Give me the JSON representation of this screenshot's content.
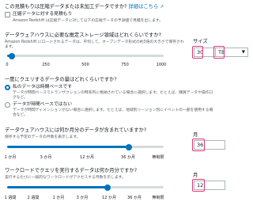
{
  "intro": {
    "question": "この見積もりは圧縮データまたは未加工データですか?",
    "link": "詳細はこちら",
    "checkbox_label": "圧縮データに対する見積もり",
    "checkbox_help": "Amazon Redshift は圧縮データに対して以下の圧縮データの予測値で見積を出します。"
  },
  "storage": {
    "question": "データウェアハウスに必要な推定ストレージ領域はどれくらいですか?",
    "help": "Amazon Redshift にロードされるデータは、平均して、オープンデータ形式の約3倍の大きさで保存されます。",
    "ticks": [
      "0",
      "250",
      "500",
      "750",
      "1000"
    ],
    "slider_fraction": 0.03,
    "size_label": "サイズ",
    "size_value": "30",
    "unit_value": "TB",
    "unit_caret": "▼"
  },
  "frequency": {
    "question": "一度にクエリするデータの量はどれくらいですか?",
    "option1_label": "私のデータは時間ベースです",
    "option1_help": "データが時間ベースでトランザクションの時系列に格納されている場合に選択します。たとえば、購買データや操作ログなど。",
    "option2_label": "データが時間ベースではない",
    "option2_help": "データが時間ディメンションがない場合に選択します。たとえば、地域別リージョン別にイベントの一部を使用する場合など。"
  },
  "months_stored": {
    "question": "データウェアハウスには何か月分のデータが含まれていますか?",
    "help": "保存する予定のデータの月数を表示します。",
    "ticks": [
      "1 か月",
      "3 か月",
      "12 か月",
      "36 か月",
      "無制限"
    ],
    "slider_fraction": 0.78,
    "field_label": "月",
    "value": "36"
  },
  "months_queried": {
    "question": "ワークロードでクエリを実行するデータは何か月分ですか?",
    "help": "実行するたびに一般的なワークロードがアクセスする月数を示します。",
    "ticks": [
      "1 週間",
      "2 週間",
      "1 か月",
      "3 か月",
      "12 か月",
      "36 か月",
      "無制限"
    ],
    "slider_fraction": 0.64,
    "field_label": "月",
    "value": "12"
  },
  "colors": {
    "accent": "#0073bb",
    "highlight": "#e4347a"
  }
}
